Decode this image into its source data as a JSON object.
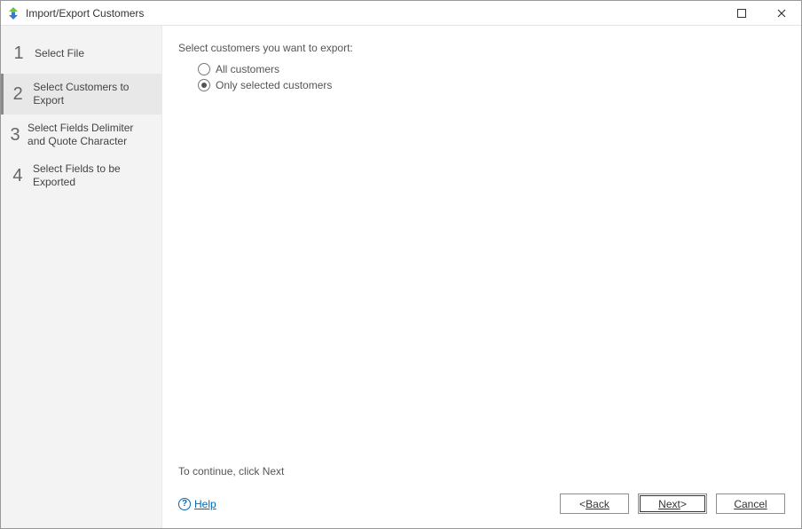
{
  "window": {
    "title": "Import/Export Customers"
  },
  "sidebar": {
    "steps": [
      {
        "num": "1",
        "label": "Select File"
      },
      {
        "num": "2",
        "label": "Select Customers to Export"
      },
      {
        "num": "3",
        "label": "Select Fields Delimiter and Quote Character"
      },
      {
        "num": "4",
        "label": "Select Fields to be Exported"
      }
    ],
    "active_index": 1
  },
  "main": {
    "instruction": "Select customers you want to export:",
    "options": {
      "all": "All customers",
      "selected": "Only selected customers",
      "chosen": "selected"
    },
    "continue_hint": "To continue, click Next"
  },
  "footer": {
    "help_label": "Help",
    "back_label": "Back",
    "next_label": "Next",
    "cancel_label": "Cancel"
  }
}
